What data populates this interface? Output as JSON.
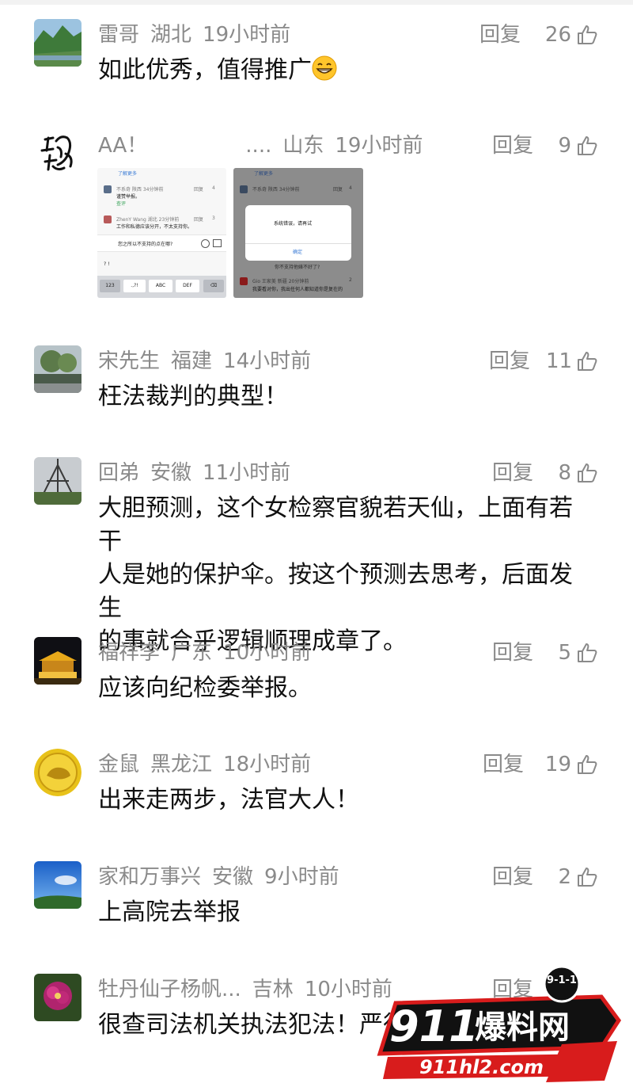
{
  "actions": {
    "reply_label": "回复"
  },
  "comments": [
    {
      "username": "雷哥",
      "location": "湖北",
      "time": "19小时前",
      "likes": "26",
      "text": "如此优秀，值得推广"
    },
    {
      "username": "AA！",
      "username_suffix": "....",
      "location": "山东",
      "time": "19小时前",
      "likes": "9",
      "text": ""
    },
    {
      "username": "宋先生",
      "location": "福建",
      "time": "14小时前",
      "likes": "11",
      "text": "枉法裁判的典型！"
    },
    {
      "username": "回弟",
      "location": "安徽",
      "time": "11小时前",
      "likes": "8",
      "lines": [
        "大胆预测，这个女检察官貌若天仙，上面有若干",
        "人是她的保护伞。按这个预测去思考，后面发生",
        "的事就合乎逻辑顺理成章了。"
      ]
    },
    {
      "username": "福祥李",
      "location": "广东",
      "time": "10小时前",
      "likes": "5",
      "text": "应该向纪检委举报。"
    },
    {
      "username": "金鼠",
      "location": "黑龙江",
      "time": "18小时前",
      "likes": "19",
      "text": "出来走两步，法官大人！"
    },
    {
      "username": "家和万事兴",
      "location": "安徽",
      "time": "9小时前",
      "likes": "2",
      "text": "上高院去举报"
    },
    {
      "username": "牡丹仙子杨帆...",
      "location": "吉林",
      "time": "10小时前",
      "likes": "",
      "text": "很查司法机关执法犯法！严征"
    }
  ],
  "embedded_screenshot_1": {
    "header": "了解更多",
    "c1_meta": "不系奇 陕西 34分钟前",
    "c1_reply": "回复",
    "c1_likes": "4",
    "c1_text": "谨赞举报。",
    "c1_sub": "查评",
    "c2_meta": "ZhenY Wang 湖北 23分钟前",
    "c2_reply": "回复",
    "c2_likes": "3",
    "c2_text": "工作和私德应该分开，不太支持你。",
    "input_text": "您之所以不支持的点在哪?",
    "symbols": "?   !",
    "keys": [
      "123",
      ".,?!",
      "ABC",
      "DEF"
    ]
  },
  "embedded_screenshot_2": {
    "header": "了解更多",
    "meta1": "不系奇 陕西 34分钟前",
    "reply": "回复",
    "likes1": "4",
    "dialog_message": "系统错误，请再试",
    "dialog_button": "确定",
    "behind_text": "你不支持他婊不好了?",
    "meta2": "Gio 王家美 新疆 20分钟前",
    "likes2": "2",
    "text2": "我要看对你，我出任何人都知道你是复在的"
  },
  "watermark": {
    "badge": "9-1-1",
    "brand_num": "911",
    "brand_cn": "爆料网",
    "url": "911hl2.com"
  },
  "colors": {
    "meta_gray": "#8a8a8a",
    "text": "#111111",
    "watermark_red": "#d81c1c"
  }
}
